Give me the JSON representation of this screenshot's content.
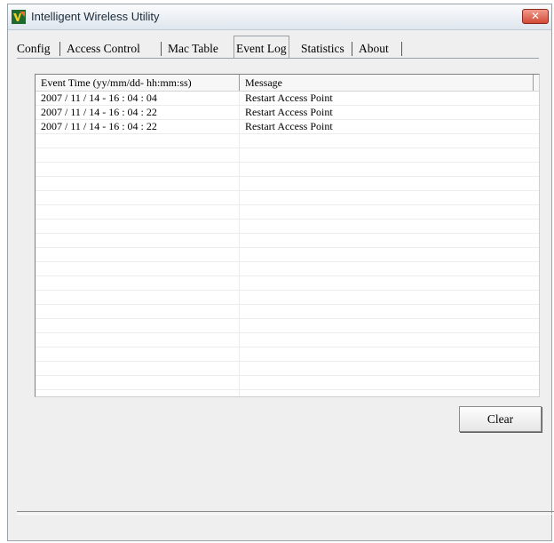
{
  "window": {
    "title": "Intelligent Wireless Utility",
    "close_glyph": "✕"
  },
  "tabs": [
    {
      "label": "Config"
    },
    {
      "label": "Access Control"
    },
    {
      "label": "Mac Table"
    },
    {
      "label": "Event Log",
      "active": true
    },
    {
      "label": "Statistics"
    },
    {
      "label": "About"
    }
  ],
  "event_log": {
    "columns": [
      "Event Time (yy/mm/dd- hh:mm:ss)",
      "Message"
    ],
    "rows": [
      {
        "time": "2007 / 11 / 14 - 16 : 04 : 04",
        "message": "Restart Access Point"
      },
      {
        "time": "2007 / 11 / 14 - 16 : 04 : 22",
        "message": "Restart Access Point"
      },
      {
        "time": "2007 / 11 / 14 - 16 : 04 : 22",
        "message": "Restart Access Point"
      }
    ]
  },
  "buttons": {
    "clear": "Clear"
  },
  "icons": {
    "app": "app-logo-icon",
    "close": "close-icon"
  }
}
